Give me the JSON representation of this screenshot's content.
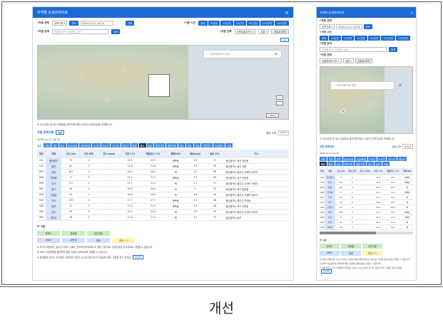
{
  "caption": "개선",
  "desktop": {
    "title": "지역별 상세관측자료",
    "close": "×",
    "row1": {
      "data_label": "•자료 선택",
      "data_select": "관측기록 ▾",
      "select_btn": "선택",
      "datetime": "2023.11.17 14:15",
      "apply_btn": "선택",
      "time_label": "•기준 시간",
      "time_buttons": [
        "현재",
        "30분전",
        "1시간전",
        "3시간전",
        "6시간전",
        "12시간전",
        "24시간전"
      ]
    },
    "row2": {
      "place_label": "•지점 검색",
      "place_placeholder": "지점명 또는 지점번호 입력",
      "search_btn": "검색",
      "point_label": "•지점 선택",
      "point_select": "강원특별자치도 ▾",
      "point_select2": "강릉 ▾",
      "map_btn": "지도로 보기"
    },
    "map": {
      "search_placeholder": "주요지명으로 입력",
      "zoom_in": "+",
      "zoom_out": "−",
      "level": "Base",
      "toggle": "접기"
    },
    "note": "※ 지도상에 표기된 지점명을 클릭하면 해당 지점의 관측자료를 조회합니다.",
    "section": {
      "title": "지점 관측자료",
      "time": "2023.11.17 14:15",
      "refresh": "갱신",
      "filter_label": "풍속 단위:",
      "filter_value": "m/s ▾",
      "elem_label": "요소",
      "elements": [
        "전체",
        "기온",
        "강수",
        "강수15분",
        "강수60분",
        "3시간",
        "6시간",
        "12시간",
        "일강수",
        "풍향",
        "풍속",
        "습도",
        "현지기압",
        "해면기압",
        "일사",
        "일조",
        "적설",
        "지면온도",
        "초상온도",
        "시정"
      ]
    },
    "table": {
      "headers": [
        "번호",
        "지점",
        "고도 (m)",
        "강수 유무",
        "강수 (mm)",
        "기온 (℃)",
        "체감온도 (℃)",
        "풍향(16)",
        "풍속(m/s)",
        "습도 (%)",
        "주소"
      ],
      "rows": [
        [
          "151",
          "울산중구",
          "73",
          "0",
          "-",
          "22.1",
          "22.1",
          "북북동",
          "1.5",
          "37",
          "울산광역시 중구 성안동"
        ],
        [
          "152",
          "울산",
          "81",
          "0",
          "-",
          "21.8",
          "21.8",
          "북북동",
          "1.5",
          "39",
          "울산광역시 중구 서동"
        ],
        [
          "854",
          "상동",
          "167",
          "0",
          "-",
          "20.2",
          "20.2",
          "북",
          "1.2",
          "38",
          "울산광역시 울주군 상북면 궁근리"
        ],
        [
          "898",
          "정자동",
          "5",
          "0",
          "-",
          "21.1",
          "21.1",
          "북북동",
          "1.3",
          "40",
          "울산광역시 남구 여천동"
        ],
        [
          "900",
          "두서",
          "117",
          "0",
          "-",
          "21.2",
          "21.2",
          "북",
          "2.7",
          "37",
          "울산광역시 울주군 두서면 구량리"
        ],
        [
          "901",
          "울기",
          "49",
          "0",
          "-",
          "20.0",
          "20.0",
          "북",
          "2",
          "53",
          "울산광역시 동구 일산동"
        ],
        [
          "904",
          "간절곶",
          "23",
          "0",
          "-",
          "20.0",
          "20.0",
          "북",
          "3.8",
          "40",
          "울산광역시 울주군 서생면 대송리"
        ],
        [
          "943",
          "약사",
          "470",
          "0",
          "-",
          "17.7",
          "17.7",
          "동북동",
          "1.1",
          "48",
          "울산광역시 울주군 약사동"
        ],
        [
          "949",
          "정자",
          "8",
          "0",
          "-",
          "21.0",
          "21.0",
          "북북동",
          "1.4",
          "48",
          "울산광역시 북구 산하동"
        ],
        [
          "956",
          "온산",
          "34",
          "0",
          "-",
          "21.3",
          "21.3",
          "북",
          "2.3",
          "34",
          "울산광역시 울주군 온산읍 이진리"
        ],
        [
          "963",
          "대덕사",
          "16",
          "0",
          "-",
          "21.0",
          "21.0",
          "북",
          "1.3",
          "35",
          "울산광역시 동구"
        ]
      ]
    },
    "legend": {
      "title": "※ 구분",
      "row1": [
        "관측소",
        "방재용",
        "유인지점"
      ],
      "row2": [
        "AWS",
        "AMOS",
        "항공",
        "기타 ( * )"
      ],
      "notes": [
        "※ 여기서 제공되는 실시간 서비스 자료는 원초적관측자료로 미 활용 가능자료 기상청 일정 공식자료로 사용될 수 없습니다.",
        "※ AWS 자료항목을 클릭하면 해당 지점의 상세자료를 조회할 수 있습니다.",
        "※ 정비알림 보수는 지자체의 다른외로 자료가 나오지 않아 분기가 필요한 경우, 다음을 참고 하세요."
      ],
      "more": "안내바"
    }
  },
  "mobile": {
    "title": "지역별 상세관측자료",
    "close": "×",
    "data_label": "•자료 선택",
    "data_select": "관측기록 ▾",
    "datetime": "2023.11.17 14:15",
    "select_btn": "선택",
    "time_label": "•기준 시간",
    "time_buttons": [
      "현재",
      "30분전",
      "1시간전",
      "3시간전",
      "6시간전",
      "12시간전",
      "24시간전"
    ],
    "place_label": "•지점 검색",
    "place_placeholder": "지점명 또는 지점번호 입력",
    "search_btn": "검색",
    "point_label": "•지점 선택",
    "point_select": "강원특별자치도 ▾",
    "point_select2": "강릉 ▾",
    "map_btn": "지도로 보기",
    "map_search": "주요지명으로 입력",
    "note": "※ 지도상에 표기된 지점명을 클릭하면 해당 지점의 관측자료를 조회합니다.",
    "section_title": "지점 관측자료",
    "time": "2023.11.17 14:15",
    "filter_label": "풍속 단위:",
    "filter_value": "m/s ▾",
    "elements": [
      "전체",
      "기온",
      "강수",
      "강수15분",
      "강수60분",
      "3시간",
      "6시간",
      "12시간",
      "일강수",
      "풍향",
      "풍속",
      "습도",
      "현지기압",
      "해면기압",
      "일사",
      "일조",
      "적설"
    ],
    "table_headers": [
      "번호",
      "지점",
      "고도 (m)",
      "강수 유무",
      "강수 (mm)",
      "기온 (℃)",
      "체감온도 (℃)",
      "풍향(16)"
    ],
    "legend_title": "※ 구분",
    "legend_row1": [
      "관측소",
      "방재용",
      "유인지점"
    ],
    "legend_row2": [
      "AWS",
      "항공",
      "기타 ( * )"
    ],
    "notes": [
      "※ 여기서 제공되는 실시간 서비스 자료는 원초적관측자료로 가능자료 기상청 공식자료로 사용될 수 없습니다.",
      "※ AWS 자료항목을 클릭하면 해당 지점의 상세자료를 조회할 수 있습니다.",
      "※ 정비알림 보수는 지자체의 다른외로 자료가 나오지 않아 분기가 필요한 경우, 다음을 참고 하세요."
    ],
    "more": "안내바"
  },
  "colors": {
    "primary": "#1c6bd6",
    "station_highlight": "#d6e5fb",
    "legend_green": "#c9ecc5",
    "legend_yellow": "#fff4b3",
    "legend_blue": "#cfe0fb"
  }
}
